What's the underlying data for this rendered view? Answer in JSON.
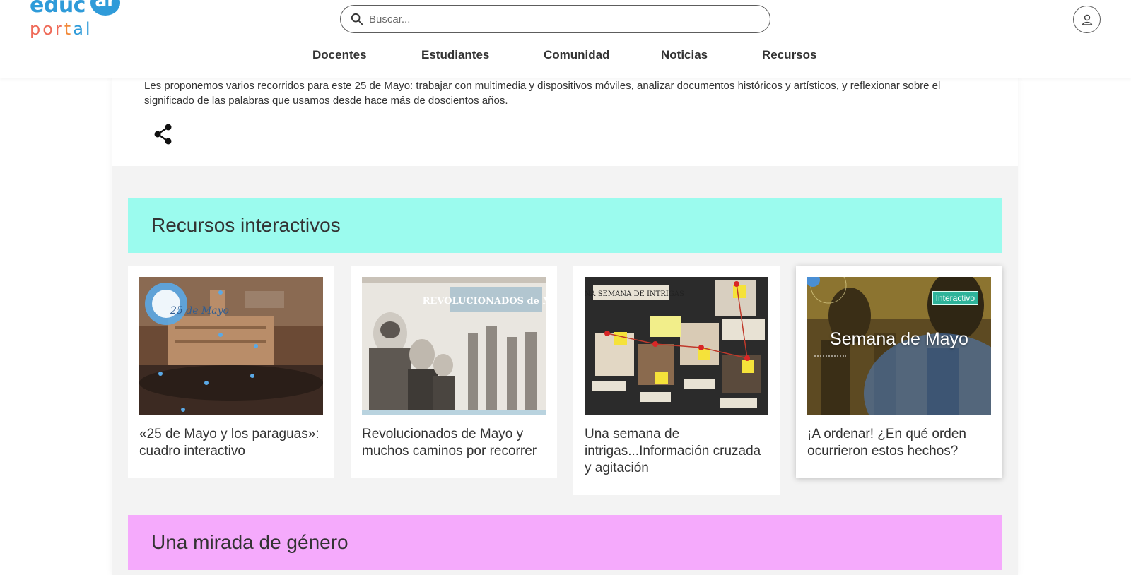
{
  "logo": {
    "word1": "educ",
    "bubble": "ar",
    "word2_a": "por",
    "word2_b": "t",
    "word2_c": "al"
  },
  "search": {
    "placeholder": "Buscar..."
  },
  "nav": {
    "items": [
      "Docentes",
      "Estudiantes",
      "Comunidad",
      "Noticias",
      "Recursos"
    ]
  },
  "intro": {
    "text": "Les proponemos varios recorridos para este 25 de Mayo: trabajar con multimedia y dispositivos móviles, analizar documentos históricos y artísticos, y reflexionar sobre el significado de las palabras que usamos desde hace más de doscientos años."
  },
  "sections": [
    {
      "title": "Recursos interactivos",
      "color": "#9bfbee"
    },
    {
      "title": "Una mirada de género",
      "color": "#f5aafc"
    }
  ],
  "cards": [
    {
      "title": "«25 de Mayo y los paraguas»: cuadro interactivo",
      "thumb_text": "25 de Mayo"
    },
    {
      "title": "Revolucionados de Mayo y muchos caminos por recorrer",
      "thumb_text": "REVOLUCIONADOS de Mayo"
    },
    {
      "title": "Una semana de intrigas...Información cruzada y agitación",
      "thumb_text": "UNA SEMANA DE INTRIGAS"
    },
    {
      "title": "¡A ordenar! ¿En qué orden ocurrieron estos hechos?",
      "badge": "Interactivo",
      "thumb_caption": "Semana de Mayo"
    }
  ],
  "colors": {
    "brand_blue": "#2f9bd9",
    "brand_orange": "#ef6a58",
    "section1": "#9bfbee",
    "section2": "#f5aafc",
    "badge": "#2eb39a"
  },
  "icons": [
    "search-icon",
    "user-icon",
    "share-icon"
  ]
}
